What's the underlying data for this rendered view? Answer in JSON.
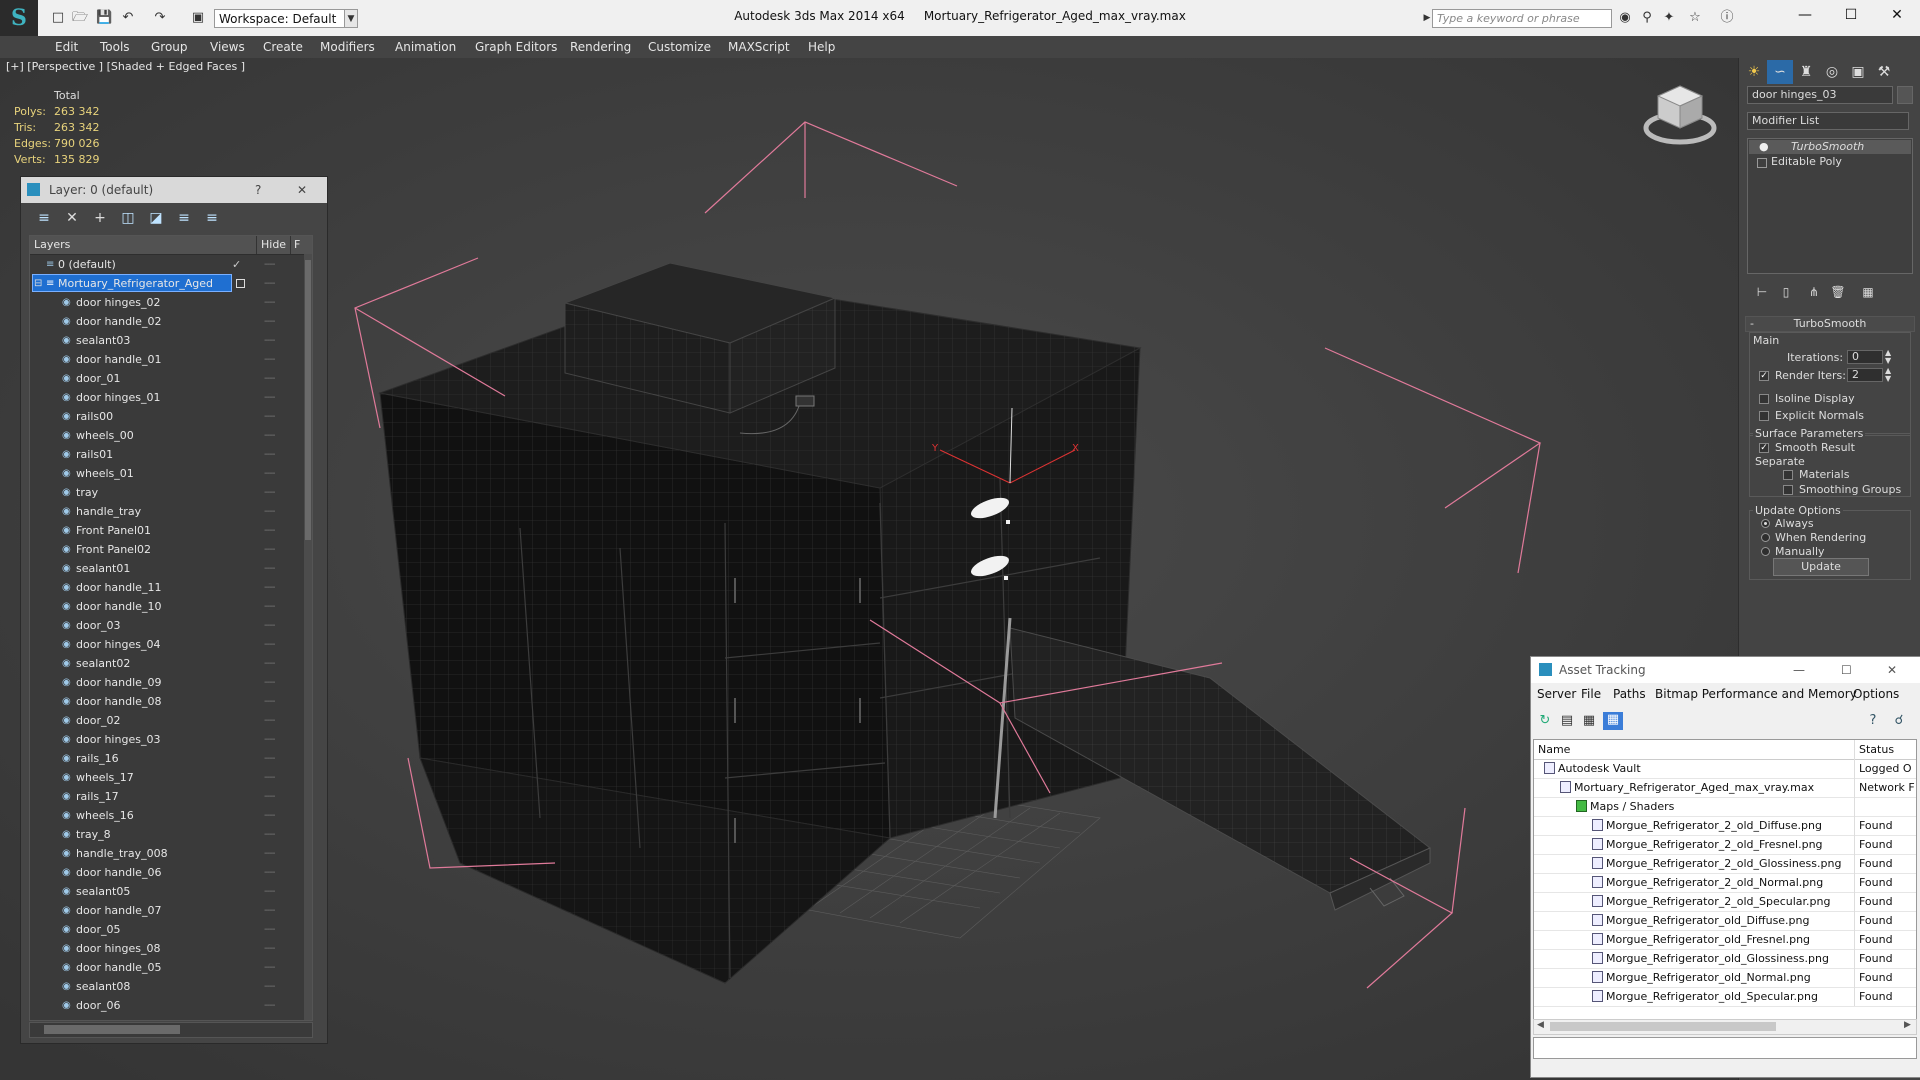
{
  "titlebar": {
    "app_title": "Autodesk 3ds Max  2014 x64",
    "file_name": "Mortuary_Refrigerator_Aged_max_vray.max",
    "workspace": "Workspace: Default",
    "search_placeholder": "Type a keyword or phrase",
    "min": "—",
    "max": "☐",
    "close": "✕"
  },
  "menu": [
    "Edit",
    "Tools",
    "Group",
    "Views",
    "Create",
    "Modifiers",
    "Animation",
    "Graph Editors",
    "Rendering",
    "Customize",
    "MAXScript",
    "Help"
  ],
  "viewport": {
    "label": "[+] [Perspective ] [Shaded + Edged Faces ]",
    "stats_header": "Total",
    "stats": [
      {
        "label": "Polys:",
        "value": "263 342"
      },
      {
        "label": "Tris:",
        "value": "263 342"
      },
      {
        "label": "Edges:",
        "value": "790 026"
      },
      {
        "label": "Verts:",
        "value": "135 829"
      }
    ]
  },
  "layer_panel": {
    "title": "Layer: 0 (default)",
    "help": "?",
    "close": "✕",
    "col_layers": "Layers",
    "col_hide": "Hide",
    "col_f": "F",
    "default_layer": "0 (default)",
    "active_layer": "Mortuary_Refrigerator_Aged",
    "objects": [
      "door hinges_02",
      "door handle_02",
      "sealant03",
      "door handle_01",
      "door_01",
      "door hinges_01",
      "rails00",
      "wheels_00",
      "rails01",
      "wheels_01",
      "tray",
      "handle_tray",
      "Front Panel01",
      "Front Panel02",
      "sealant01",
      "door handle_11",
      "door handle_10",
      "door_03",
      "door hinges_04",
      "sealant02",
      "door handle_09",
      "door handle_08",
      "door_02",
      "door hinges_03",
      "rails_16",
      "wheels_17",
      "rails_17",
      "wheels_16",
      "tray_8",
      "handle_tray_008",
      "door handle_06",
      "sealant05",
      "door handle_07",
      "door_05",
      "door hinges_08",
      "door handle_05",
      "sealant08",
      "door_06"
    ]
  },
  "command_panel": {
    "object_name": "door hinges_03",
    "modifier_list": "Modifier List",
    "stack": [
      "TurboSmooth",
      "Editable Poly"
    ],
    "rollout_title": "TurboSmooth",
    "main_label": "Main",
    "iterations_label": "Iterations:",
    "iterations_value": "0",
    "render_iters_label": "Render Iters:",
    "render_iters_value": "2",
    "isoline": "Isoline Display",
    "explicit_normals": "Explicit Normals",
    "surface_params": "Surface Parameters",
    "smooth_result": "Smooth Result",
    "separate": "Separate",
    "materials": "Materials",
    "smoothing_groups": "Smoothing Groups",
    "update_options": "Update Options",
    "always": "Always",
    "when_rendering": "When Rendering",
    "manually": "Manually",
    "update_btn": "Update",
    "collapse": "-"
  },
  "asset_tracking": {
    "title": "Asset Tracking",
    "menu": [
      "Server",
      "File",
      "Paths",
      "Bitmap Performance and Memory",
      "Options"
    ],
    "col_name": "Name",
    "col_status": "Status",
    "rows": [
      {
        "name": "Autodesk Vault",
        "status": "Logged O"
      },
      {
        "name": "Mortuary_Refrigerator_Aged_max_vray.max",
        "status": "Network F"
      },
      {
        "name": "Maps / Shaders",
        "status": ""
      },
      {
        "name": "Morgue_Refrigerator_2_old_Diffuse.png",
        "status": "Found"
      },
      {
        "name": "Morgue_Refrigerator_2_old_Fresnel.png",
        "status": "Found"
      },
      {
        "name": "Morgue_Refrigerator_2_old_Glossiness.png",
        "status": "Found"
      },
      {
        "name": "Morgue_Refrigerator_2_old_Normal.png",
        "status": "Found"
      },
      {
        "name": "Morgue_Refrigerator_2_old_Specular.png",
        "status": "Found"
      },
      {
        "name": "Morgue_Refrigerator_old_Diffuse.png",
        "status": "Found"
      },
      {
        "name": "Morgue_Refrigerator_old_Fresnel.png",
        "status": "Found"
      },
      {
        "name": "Morgue_Refrigerator_old_Glossiness.png",
        "status": "Found"
      },
      {
        "name": "Morgue_Refrigerator_old_Normal.png",
        "status": "Found"
      },
      {
        "name": "Morgue_Refrigerator_old_Specular.png",
        "status": "Found"
      }
    ]
  },
  "colors": {
    "selection": "#1f6fd1",
    "stats": "#e8d37c",
    "bbox": "#e07a9a"
  }
}
